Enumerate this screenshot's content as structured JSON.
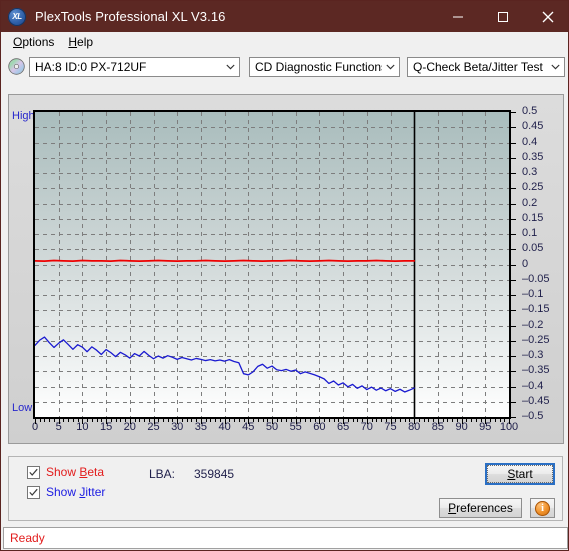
{
  "window": {
    "title": "PlexTools Professional XL V3.16",
    "icon": "xl-app-icon",
    "icon_text": "XL",
    "titlebar_color": "#5c2823",
    "minimize": "–",
    "maximize": "□",
    "close": "✕"
  },
  "menu": {
    "items": [
      {
        "label": "Options",
        "accel": "O"
      },
      {
        "label": "Help",
        "accel": "H"
      }
    ]
  },
  "toolbar": {
    "drive_icon": "cd-disc-icon",
    "drive_select": {
      "value": "HA:8 ID:0  PX-712UF",
      "options": [
        "HA:8 ID:0  PX-712UF"
      ]
    },
    "function_select": {
      "value": "CD Diagnostic Functions",
      "options": [
        "CD Diagnostic Functions"
      ]
    },
    "test_select": {
      "value": "Q-Check Beta/Jitter Test",
      "options": [
        "Q-Check Beta/Jitter Test"
      ]
    }
  },
  "controls": {
    "show_beta": {
      "label_prefix": "Show ",
      "label_accel": "B",
      "label_suffix": "eta",
      "checked": true,
      "color": "#e21c1c"
    },
    "show_jitter": {
      "label_prefix": "Show ",
      "label_accel": "J",
      "label_suffix": "itter",
      "checked": true,
      "color": "#1c1ce2"
    },
    "lba_label": "LBA:",
    "lba_value": "359845",
    "start_button": {
      "prefix": "",
      "accel": "S",
      "suffix": "tart",
      "focused": true
    },
    "preferences_button": {
      "prefix": "",
      "accel": "P",
      "suffix": "references"
    },
    "info_button": {
      "icon": "info-icon",
      "glyph": "i"
    }
  },
  "status": {
    "text": "Ready",
    "color": "#e21c1c"
  },
  "chart_data": {
    "type": "line",
    "title": "Q-Check Beta/Jitter Test",
    "xlabel": "",
    "ylabel": "",
    "xlim": [
      0,
      100
    ],
    "ylim": [
      -0.5,
      0.5
    ],
    "grid": true,
    "y_axis_side": "right",
    "y_high_label": "High",
    "y_low_label": "Low",
    "xticks": [
      0,
      5,
      10,
      15,
      20,
      25,
      30,
      35,
      40,
      45,
      50,
      55,
      60,
      65,
      70,
      75,
      80,
      85,
      90,
      95,
      100
    ],
    "yticks": [
      0.5,
      0.45,
      0.4,
      0.35,
      0.3,
      0.25,
      0.2,
      0.15,
      0.1,
      0.05,
      0,
      -0.05,
      -0.1,
      -0.15,
      -0.2,
      -0.25,
      -0.3,
      -0.35,
      -0.4,
      -0.45,
      -0.5
    ],
    "data_end_marker_x": 80,
    "series": [
      {
        "name": "Beta",
        "color": "#ee0000",
        "x": [
          0,
          2,
          4,
          6,
          8,
          10,
          12,
          14,
          16,
          18,
          20,
          22,
          24,
          26,
          28,
          30,
          32,
          34,
          36,
          38,
          40,
          42,
          44,
          46,
          48,
          50,
          52,
          54,
          56,
          58,
          60,
          62,
          64,
          66,
          68,
          70,
          72,
          74,
          76,
          78,
          80
        ],
        "values": [
          0.012,
          0.011,
          0.013,
          0.012,
          0.011,
          0.013,
          0.012,
          0.012,
          0.011,
          0.013,
          0.012,
          0.011,
          0.012,
          0.013,
          0.012,
          0.011,
          0.012,
          0.012,
          0.013,
          0.012,
          0.011,
          0.012,
          0.013,
          0.012,
          0.011,
          0.012,
          0.012,
          0.013,
          0.012,
          0.011,
          0.012,
          0.013,
          0.012,
          0.011,
          0.012,
          0.012,
          0.013,
          0.012,
          0.011,
          0.012,
          0.012
        ]
      },
      {
        "name": "Jitter",
        "color": "#1a1ad0",
        "x": [
          0,
          1,
          2,
          3,
          4,
          5,
          6,
          7,
          8,
          9,
          10,
          11,
          12,
          13,
          14,
          15,
          16,
          17,
          18,
          19,
          20,
          21,
          22,
          23,
          24,
          25,
          26,
          27,
          28,
          29,
          30,
          31,
          32,
          33,
          34,
          35,
          36,
          37,
          38,
          39,
          40,
          41,
          42,
          43,
          44,
          45,
          46,
          47,
          48,
          49,
          50,
          51,
          52,
          53,
          54,
          55,
          56,
          57,
          58,
          59,
          60,
          61,
          62,
          63,
          64,
          65,
          66,
          67,
          68,
          69,
          70,
          71,
          72,
          73,
          74,
          75,
          76,
          77,
          78,
          79,
          80
        ],
        "values": [
          -0.265,
          -0.248,
          -0.238,
          -0.256,
          -0.272,
          -0.258,
          -0.247,
          -0.262,
          -0.278,
          -0.263,
          -0.271,
          -0.286,
          -0.27,
          -0.281,
          -0.295,
          -0.279,
          -0.289,
          -0.302,
          -0.288,
          -0.296,
          -0.307,
          -0.292,
          -0.3,
          -0.285,
          -0.298,
          -0.309,
          -0.3,
          -0.307,
          -0.299,
          -0.304,
          -0.311,
          -0.305,
          -0.309,
          -0.313,
          -0.308,
          -0.311,
          -0.315,
          -0.312,
          -0.316,
          -0.313,
          -0.317,
          -0.312,
          -0.318,
          -0.322,
          -0.358,
          -0.362,
          -0.352,
          -0.334,
          -0.327,
          -0.34,
          -0.333,
          -0.345,
          -0.348,
          -0.344,
          -0.35,
          -0.346,
          -0.358,
          -0.352,
          -0.357,
          -0.362,
          -0.368,
          -0.375,
          -0.39,
          -0.382,
          -0.395,
          -0.388,
          -0.401,
          -0.393,
          -0.406,
          -0.398,
          -0.41,
          -0.402,
          -0.412,
          -0.405,
          -0.414,
          -0.407,
          -0.416,
          -0.409,
          -0.418,
          -0.412,
          -0.405
        ]
      }
    ]
  }
}
